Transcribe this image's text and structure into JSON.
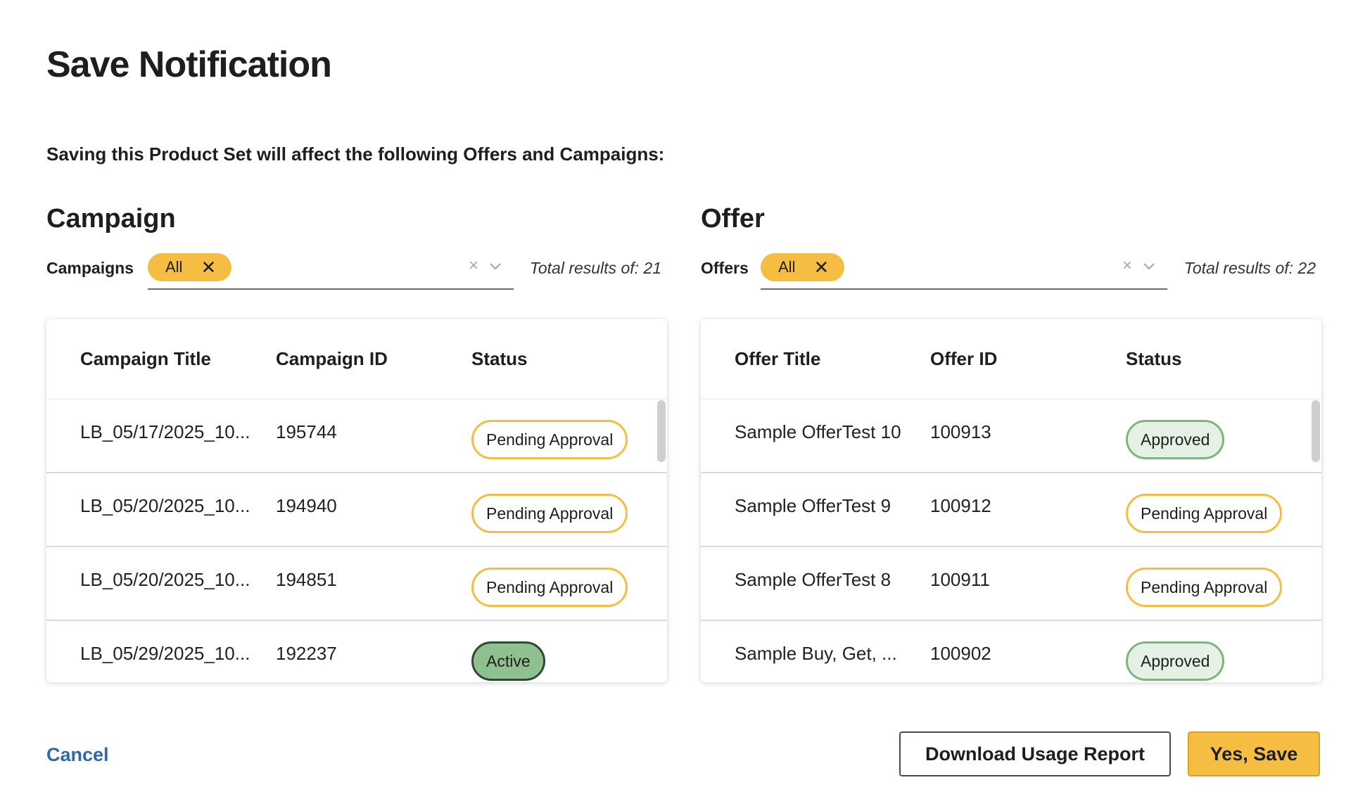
{
  "dialog": {
    "title": "Save Notification",
    "subtitle": "Saving this Product Set will affect the following Offers and Campaigns:"
  },
  "campaign": {
    "section_title": "Campaign",
    "filter_label": "Campaigns",
    "chip_label": "All",
    "clear_glyph": "×",
    "total_results": "Total results of: 21",
    "columns": [
      "Campaign Title",
      "Campaign ID",
      "Status"
    ],
    "rows": [
      {
        "title": "LB_05/17/2025_10...",
        "id": "195744",
        "status": "Pending Approval",
        "status_type": "pending"
      },
      {
        "title": "LB_05/20/2025_10...",
        "id": "194940",
        "status": "Pending Approval",
        "status_type": "pending"
      },
      {
        "title": "LB_05/20/2025_10...",
        "id": "194851",
        "status": "Pending Approval",
        "status_type": "pending"
      },
      {
        "title": "LB_05/29/2025_10...",
        "id": "192237",
        "status": "Active",
        "status_type": "active"
      }
    ]
  },
  "offer": {
    "section_title": "Offer",
    "filter_label": "Offers",
    "chip_label": "All",
    "clear_glyph": "×",
    "total_results": "Total results of: 22",
    "columns": [
      "Offer Title",
      "Offer ID",
      "Status"
    ],
    "rows": [
      {
        "title": "Sample OfferTest 10",
        "id": "100913",
        "status": "Approved",
        "status_type": "approved"
      },
      {
        "title": "Sample OfferTest 9",
        "id": "100912",
        "status": "Pending Approval",
        "status_type": "pending"
      },
      {
        "title": "Sample OfferTest 8",
        "id": "100911",
        "status": "Pending Approval",
        "status_type": "pending"
      },
      {
        "title": "Sample Buy, Get, ...",
        "id": "100902",
        "status": "Approved",
        "status_type": "approved"
      }
    ]
  },
  "footer": {
    "cancel_label": "Cancel",
    "download_label": "Download Usage Report",
    "save_label": "Yes, Save"
  },
  "colors": {
    "accent_yellow": "#f5bd41",
    "link_blue": "#2f6aa8",
    "approved_green": "#7fb37f",
    "active_green": "#8fc08f"
  }
}
